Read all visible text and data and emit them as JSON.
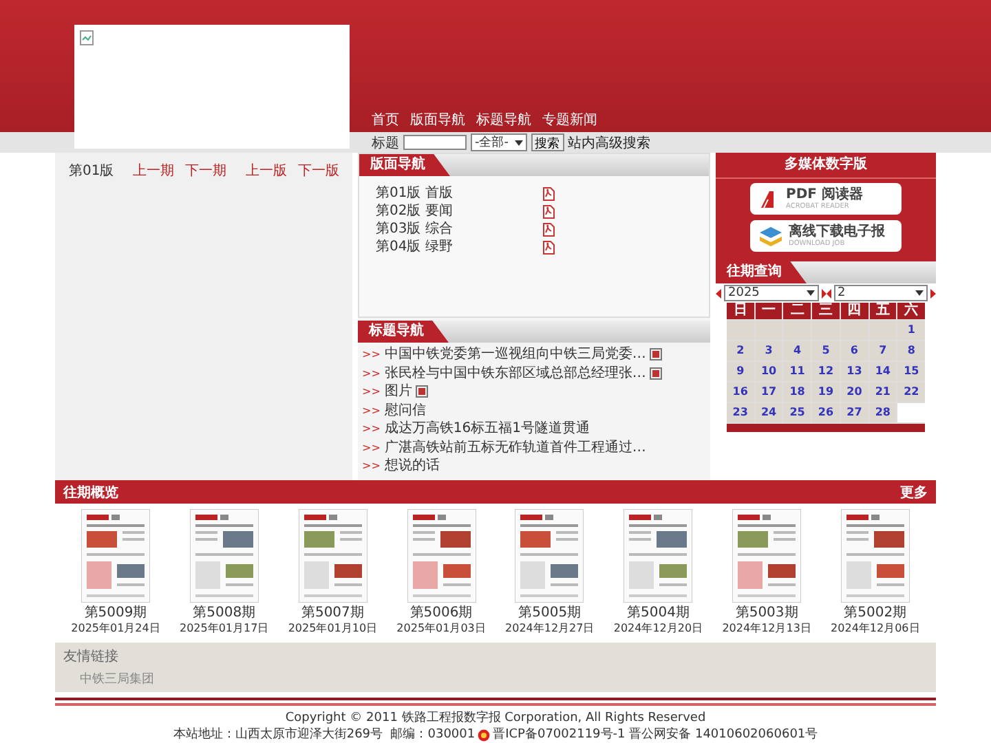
{
  "header": {
    "nav": [
      "首页",
      "版面导航",
      "标题导航",
      "专题新闻"
    ],
    "search": {
      "label": "标题",
      "scope": "-全部-",
      "button": "搜索",
      "advanced": "站内高级搜索"
    }
  },
  "page_nav": {
    "current": "第01版",
    "issue_links": [
      "上一期",
      "下一期"
    ],
    "page_links": [
      "上一版",
      "下一版"
    ]
  },
  "layout_nav": {
    "title": "版面导航",
    "items": [
      {
        "label": "第01版 首版"
      },
      {
        "label": "第02版 要闻"
      },
      {
        "label": "第03版 综合"
      },
      {
        "label": "第04版 绿野"
      }
    ]
  },
  "title_nav": {
    "title": "标题导航",
    "items": [
      {
        "prefix": ">>",
        "label": "中国中铁党委第一巡视组向中铁三局党委…",
        "has_attachment": true
      },
      {
        "prefix": ">>",
        "label": "张民栓与中国中铁东部区域总部总经理张…",
        "has_attachment": true
      },
      {
        "prefix": ">>",
        "label": "图片",
        "has_attachment": true
      },
      {
        "prefix": ">>",
        "label": "慰问信",
        "has_attachment": false
      },
      {
        "prefix": ">>",
        "label": "成达万高铁16标五福1号隧道贯通",
        "has_attachment": false
      },
      {
        "prefix": ">>",
        "label": "广湛高铁站前五标无砟轨道首件工程通过…",
        "has_attachment": false
      },
      {
        "prefix": ">>",
        "label": "想说的话",
        "has_attachment": false
      }
    ]
  },
  "media": {
    "title": "多媒体数字版",
    "buttons": [
      {
        "kind": "pdf",
        "label": "PDF 阅读器",
        "sublabel": "ACROBAT READER"
      },
      {
        "kind": "download",
        "label": "离线下载电子报",
        "sublabel": "DOWNLOAD JOB"
      }
    ]
  },
  "archive": {
    "title": "往期查询",
    "year": "2025",
    "month": "2",
    "weekdays": [
      "日",
      "一",
      "二",
      "三",
      "四",
      "五",
      "六"
    ],
    "cells": [
      {
        "kind": "pad"
      },
      {
        "kind": "pad"
      },
      {
        "kind": "pad"
      },
      {
        "kind": "pad"
      },
      {
        "kind": "pad"
      },
      {
        "kind": "pad"
      },
      {
        "kind": "day",
        "day": "1"
      },
      {
        "kind": "day",
        "day": "2"
      },
      {
        "kind": "day",
        "day": "3"
      },
      {
        "kind": "day",
        "day": "4"
      },
      {
        "kind": "day",
        "day": "5"
      },
      {
        "kind": "day",
        "day": "6"
      },
      {
        "kind": "day",
        "day": "7"
      },
      {
        "kind": "day",
        "day": "8"
      },
      {
        "kind": "day",
        "day": "9"
      },
      {
        "kind": "day",
        "day": "10"
      },
      {
        "kind": "day",
        "day": "11"
      },
      {
        "kind": "day",
        "day": "12"
      },
      {
        "kind": "day",
        "day": "13"
      },
      {
        "kind": "day",
        "day": "14"
      },
      {
        "kind": "day",
        "day": "15"
      },
      {
        "kind": "day",
        "day": "16"
      },
      {
        "kind": "day",
        "day": "17"
      },
      {
        "kind": "day",
        "day": "18"
      },
      {
        "kind": "day",
        "day": "19"
      },
      {
        "kind": "day",
        "day": "20"
      },
      {
        "kind": "day",
        "day": "21"
      },
      {
        "kind": "day",
        "day": "22"
      },
      {
        "kind": "day",
        "day": "23"
      },
      {
        "kind": "day",
        "day": "24"
      },
      {
        "kind": "day",
        "day": "25"
      },
      {
        "kind": "day",
        "day": "26"
      },
      {
        "kind": "day",
        "day": "27"
      },
      {
        "kind": "day",
        "day": "28"
      },
      {
        "kind": "none"
      }
    ]
  },
  "gallery": {
    "title": "往期概览",
    "more": "更多",
    "issues": [
      {
        "issue": "第5009期",
        "date": "2025年01月24日",
        "kind": "picture"
      },
      {
        "issue": "第5008期",
        "date": "2025年01月17日",
        "kind": "picture"
      },
      {
        "issue": "第5007期",
        "date": "2025年01月10日",
        "kind": "picture"
      },
      {
        "issue": "第5006期",
        "date": "2025年01月03日",
        "kind": "picture"
      },
      {
        "issue": "第5005期",
        "date": "2024年12月27日",
        "kind": "picture"
      },
      {
        "issue": "第5004期",
        "date": "2024年12月20日",
        "kind": "picture"
      },
      {
        "issue": "第5003期",
        "date": "2024年12月13日",
        "kind": "picture"
      },
      {
        "issue": "第5002期",
        "date": "2024年12月06日",
        "kind": "picture"
      }
    ]
  },
  "links": {
    "title": "友情链接",
    "items": [
      "中铁三局集团"
    ]
  },
  "footer": {
    "copyright": "Copyright © 2011 铁路工程报数字报 Corporation, All Rights Reserved",
    "address": "本站地址：山西太原市迎泽大街269号  邮编：030001",
    "icp": "晋ICP备07002119号-1 晋公网安备 14010602060601号"
  }
}
